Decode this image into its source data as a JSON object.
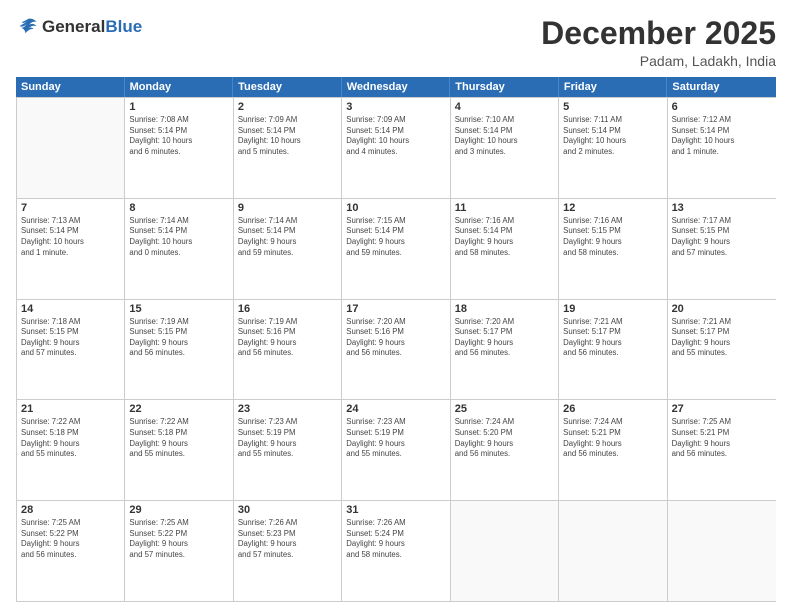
{
  "header": {
    "logo_general": "General",
    "logo_blue": "Blue",
    "month_title": "December 2025",
    "location": "Padam, Ladakh, India"
  },
  "weekdays": [
    "Sunday",
    "Monday",
    "Tuesday",
    "Wednesday",
    "Thursday",
    "Friday",
    "Saturday"
  ],
  "rows": [
    [
      {
        "day": "",
        "info": ""
      },
      {
        "day": "1",
        "info": "Sunrise: 7:08 AM\nSunset: 5:14 PM\nDaylight: 10 hours\nand 6 minutes."
      },
      {
        "day": "2",
        "info": "Sunrise: 7:09 AM\nSunset: 5:14 PM\nDaylight: 10 hours\nand 5 minutes."
      },
      {
        "day": "3",
        "info": "Sunrise: 7:09 AM\nSunset: 5:14 PM\nDaylight: 10 hours\nand 4 minutes."
      },
      {
        "day": "4",
        "info": "Sunrise: 7:10 AM\nSunset: 5:14 PM\nDaylight: 10 hours\nand 3 minutes."
      },
      {
        "day": "5",
        "info": "Sunrise: 7:11 AM\nSunset: 5:14 PM\nDaylight: 10 hours\nand 2 minutes."
      },
      {
        "day": "6",
        "info": "Sunrise: 7:12 AM\nSunset: 5:14 PM\nDaylight: 10 hours\nand 1 minute."
      }
    ],
    [
      {
        "day": "7",
        "info": "Sunrise: 7:13 AM\nSunset: 5:14 PM\nDaylight: 10 hours\nand 1 minute."
      },
      {
        "day": "8",
        "info": "Sunrise: 7:14 AM\nSunset: 5:14 PM\nDaylight: 10 hours\nand 0 minutes."
      },
      {
        "day": "9",
        "info": "Sunrise: 7:14 AM\nSunset: 5:14 PM\nDaylight: 9 hours\nand 59 minutes."
      },
      {
        "day": "10",
        "info": "Sunrise: 7:15 AM\nSunset: 5:14 PM\nDaylight: 9 hours\nand 59 minutes."
      },
      {
        "day": "11",
        "info": "Sunrise: 7:16 AM\nSunset: 5:14 PM\nDaylight: 9 hours\nand 58 minutes."
      },
      {
        "day": "12",
        "info": "Sunrise: 7:16 AM\nSunset: 5:15 PM\nDaylight: 9 hours\nand 58 minutes."
      },
      {
        "day": "13",
        "info": "Sunrise: 7:17 AM\nSunset: 5:15 PM\nDaylight: 9 hours\nand 57 minutes."
      }
    ],
    [
      {
        "day": "14",
        "info": "Sunrise: 7:18 AM\nSunset: 5:15 PM\nDaylight: 9 hours\nand 57 minutes."
      },
      {
        "day": "15",
        "info": "Sunrise: 7:19 AM\nSunset: 5:15 PM\nDaylight: 9 hours\nand 56 minutes."
      },
      {
        "day": "16",
        "info": "Sunrise: 7:19 AM\nSunset: 5:16 PM\nDaylight: 9 hours\nand 56 minutes."
      },
      {
        "day": "17",
        "info": "Sunrise: 7:20 AM\nSunset: 5:16 PM\nDaylight: 9 hours\nand 56 minutes."
      },
      {
        "day": "18",
        "info": "Sunrise: 7:20 AM\nSunset: 5:17 PM\nDaylight: 9 hours\nand 56 minutes."
      },
      {
        "day": "19",
        "info": "Sunrise: 7:21 AM\nSunset: 5:17 PM\nDaylight: 9 hours\nand 56 minutes."
      },
      {
        "day": "20",
        "info": "Sunrise: 7:21 AM\nSunset: 5:17 PM\nDaylight: 9 hours\nand 55 minutes."
      }
    ],
    [
      {
        "day": "21",
        "info": "Sunrise: 7:22 AM\nSunset: 5:18 PM\nDaylight: 9 hours\nand 55 minutes."
      },
      {
        "day": "22",
        "info": "Sunrise: 7:22 AM\nSunset: 5:18 PM\nDaylight: 9 hours\nand 55 minutes."
      },
      {
        "day": "23",
        "info": "Sunrise: 7:23 AM\nSunset: 5:19 PM\nDaylight: 9 hours\nand 55 minutes."
      },
      {
        "day": "24",
        "info": "Sunrise: 7:23 AM\nSunset: 5:19 PM\nDaylight: 9 hours\nand 55 minutes."
      },
      {
        "day": "25",
        "info": "Sunrise: 7:24 AM\nSunset: 5:20 PM\nDaylight: 9 hours\nand 56 minutes."
      },
      {
        "day": "26",
        "info": "Sunrise: 7:24 AM\nSunset: 5:21 PM\nDaylight: 9 hours\nand 56 minutes."
      },
      {
        "day": "27",
        "info": "Sunrise: 7:25 AM\nSunset: 5:21 PM\nDaylight: 9 hours\nand 56 minutes."
      }
    ],
    [
      {
        "day": "28",
        "info": "Sunrise: 7:25 AM\nSunset: 5:22 PM\nDaylight: 9 hours\nand 56 minutes."
      },
      {
        "day": "29",
        "info": "Sunrise: 7:25 AM\nSunset: 5:22 PM\nDaylight: 9 hours\nand 57 minutes."
      },
      {
        "day": "30",
        "info": "Sunrise: 7:26 AM\nSunset: 5:23 PM\nDaylight: 9 hours\nand 57 minutes."
      },
      {
        "day": "31",
        "info": "Sunrise: 7:26 AM\nSunset: 5:24 PM\nDaylight: 9 hours\nand 58 minutes."
      },
      {
        "day": "",
        "info": ""
      },
      {
        "day": "",
        "info": ""
      },
      {
        "day": "",
        "info": ""
      }
    ]
  ]
}
